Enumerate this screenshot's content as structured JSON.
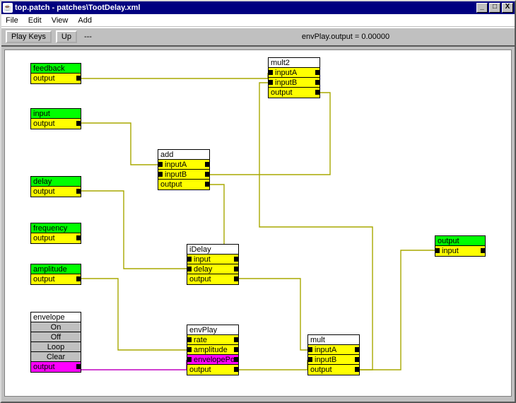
{
  "window": {
    "title": "top.patch - patches\\TootDelay.xml"
  },
  "menu": {
    "file": "File",
    "edit": "Edit",
    "view": "View",
    "add": "Add"
  },
  "toolbar": {
    "play_keys": "Play Keys",
    "up": "Up",
    "dash": "---",
    "status": "envPlay.output =  0.00000"
  },
  "nodes": {
    "feedback": {
      "title": "feedback",
      "out": "output"
    },
    "input": {
      "title": "input",
      "out": "output"
    },
    "delay": {
      "title": "delay",
      "out": "output"
    },
    "frequency": {
      "title": "frequency",
      "out": "output"
    },
    "amplitude": {
      "title": "amplitude",
      "out": "output"
    },
    "envelope": {
      "title": "envelope",
      "on": "On",
      "off": "Off",
      "loop": "Loop",
      "clear": "Clear",
      "out": "output"
    },
    "add": {
      "title": "add",
      "a": "inputA",
      "b": "inputB",
      "out": "output"
    },
    "iDelay": {
      "title": "iDelay",
      "in": "input",
      "d": "delay",
      "out": "output"
    },
    "envPlay": {
      "title": "envPlay",
      "rate": "rate",
      "amp": "amplitude",
      "env": "envelopePo",
      "out": "output"
    },
    "mult2": {
      "title": "mult2",
      "a": "inputA",
      "b": "inputB",
      "out": "output"
    },
    "mult": {
      "title": "mult",
      "a": "inputA",
      "b": "inputB",
      "out": "output"
    },
    "output": {
      "title": "output",
      "in": "input"
    }
  }
}
